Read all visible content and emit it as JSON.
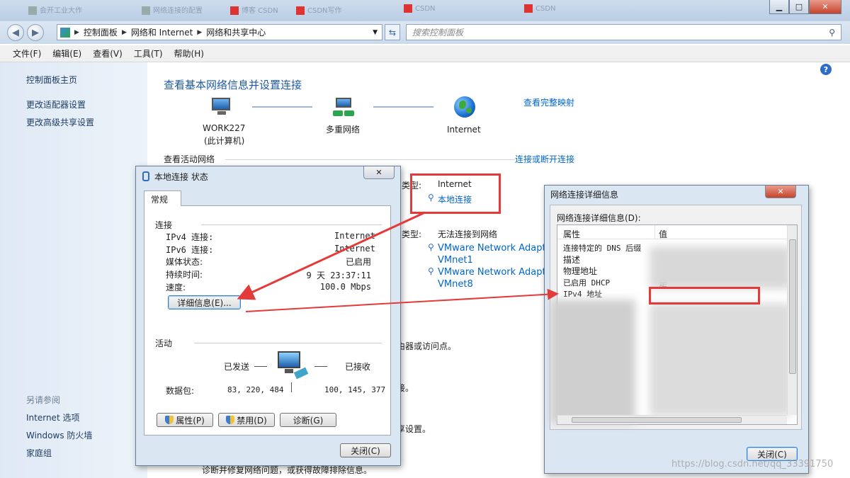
{
  "browser_tabs": [
    {
      "label": "会开工业大作"
    },
    {
      "label": "网络连接的配置"
    },
    {
      "label": "博客 CSDN"
    },
    {
      "label": "CSDN写作"
    },
    {
      "label": "CSDN"
    },
    {
      "label": "CSDN"
    }
  ],
  "window_controls": {
    "minimize": "▁",
    "maximize": "□",
    "close": "✕"
  },
  "address": {
    "crumbs": [
      "控制面板",
      "网络和 Internet",
      "网络和共享中心"
    ],
    "search_placeholder": "搜索控制面板"
  },
  "menu": [
    "文件(F)",
    "编辑(E)",
    "查看(V)",
    "工具(T)",
    "帮助(H)"
  ],
  "sidebar": {
    "links": [
      "控制面板主页",
      "更改适配器设置",
      "更改高级共享设置"
    ],
    "see_also_heading": "另请参阅",
    "see_also": [
      "Internet 选项",
      "Windows 防火墙",
      "家庭组"
    ]
  },
  "main": {
    "heading": "查看基本网络信息并设置连接",
    "view_full_map": "查看完整映射",
    "nodes": {
      "computer_name": "WORK227",
      "computer_sub": "(此计算机)",
      "multi_network": "多重网络",
      "internet": "Internet"
    },
    "active_networks_label": "查看活动网络",
    "connect_disconnect": "连接或断开连接",
    "access_type_label_1": "类型:",
    "access_type_value_1": "Internet",
    "connection_link_1": "本地连接",
    "access_type_label_2": "类型:",
    "access_type_value_2": "无法连接到网络",
    "adapter_links": [
      "VMware Network Adapter",
      "VMnet1",
      "VMware Network Adapter",
      "VMnet8"
    ],
    "partial_texts": [
      "由器或访问点。",
      "接。",
      "享设置。",
      "诊断并修复网络问题，或获得故障排除信息。"
    ]
  },
  "status_dialog": {
    "title": "本地连接 状态",
    "tab": "常规",
    "connection_section": "连接",
    "rows": [
      {
        "label": "IPv4 连接:",
        "value": "Internet"
      },
      {
        "label": "IPv6 连接:",
        "value": "Internet"
      },
      {
        "label": "媒体状态:",
        "value": "已启用"
      },
      {
        "label": "持续时间:",
        "value": "9 天 23:37:11"
      },
      {
        "label": "速度:",
        "value": "100.0 Mbps"
      }
    ],
    "details_button": "详细信息(E)...",
    "activity_section": "活动",
    "sent_label": "已发送",
    "received_label": "已接收",
    "packets_label": "数据包:",
    "packets_sent": "83, 220, 484",
    "packets_received": "100, 145, 377",
    "properties_button": "属性(P)",
    "disable_button": "禁用(D)",
    "diagnose_button": "诊断(G)",
    "close_button": "关闭(C)"
  },
  "details_dialog": {
    "title": "网络连接详细信息",
    "caption": "网络连接详细信息(D):",
    "col_property": "属性",
    "col_value": "值",
    "rows": [
      {
        "property": "连接特定的 DNS 后缀"
      },
      {
        "property": "描述"
      },
      {
        "property": "物理地址"
      },
      {
        "property": "已启用 DHCP",
        "value": "是"
      },
      {
        "property": "IPv4 地址"
      }
    ],
    "close_button": "关闭(C)"
  },
  "watermark": "https://blog.csdn.net/qq_33391750",
  "colors": {
    "highlight_red": "#e43a3a",
    "link_blue": "#0066cc",
    "heading_blue": "#1e5aa8"
  }
}
